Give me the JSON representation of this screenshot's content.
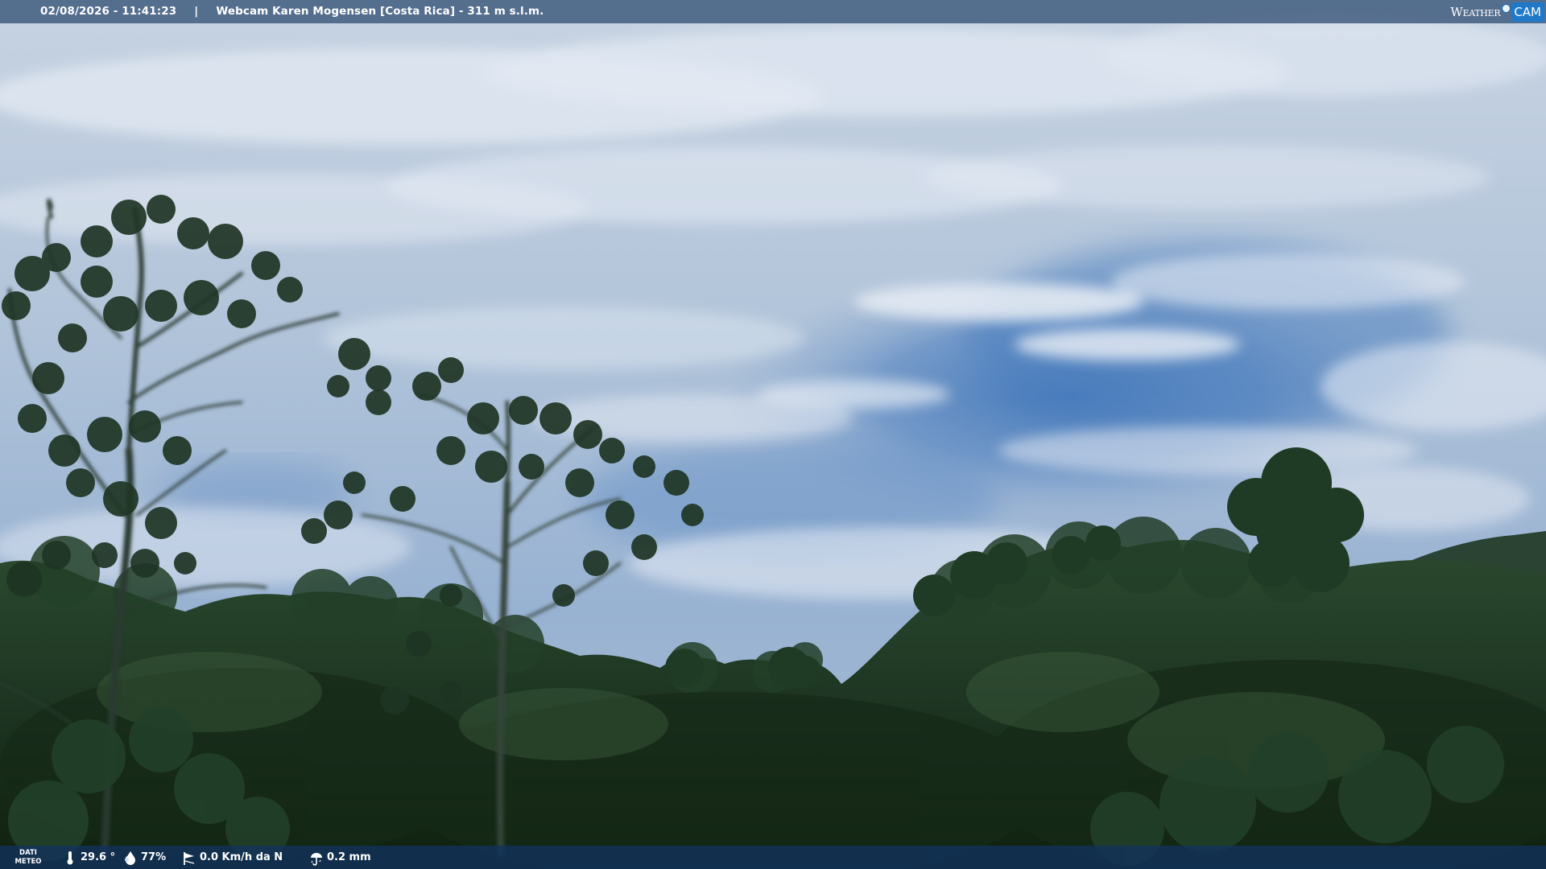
{
  "overlay_top": {
    "datetime": "02/08/2026 - 11:41:23",
    "separator": "|",
    "location": "Webcam Karen Mogensen [Costa Rica]  - 311 m s.l.m."
  },
  "brand": {
    "weather": "Weather",
    "cam": "CAM",
    "accent_color": "#1f79c8"
  },
  "weather_bar": {
    "label_line1": "DATI",
    "label_line2": "METEO",
    "temperature": "29.6 °",
    "humidity": "77%",
    "wind": "0.0 Km/h da N",
    "rain": "0.2 mm",
    "icons": [
      "thermometer-icon",
      "humidity-icon",
      "wind-icon",
      "rain-icon"
    ]
  },
  "scene": {
    "description_colors": {
      "sky_top": "#9cb1cc",
      "sky_blue": "#4d7fbe",
      "cloud": "#dde6f1",
      "forest": "#1f3a26"
    }
  }
}
